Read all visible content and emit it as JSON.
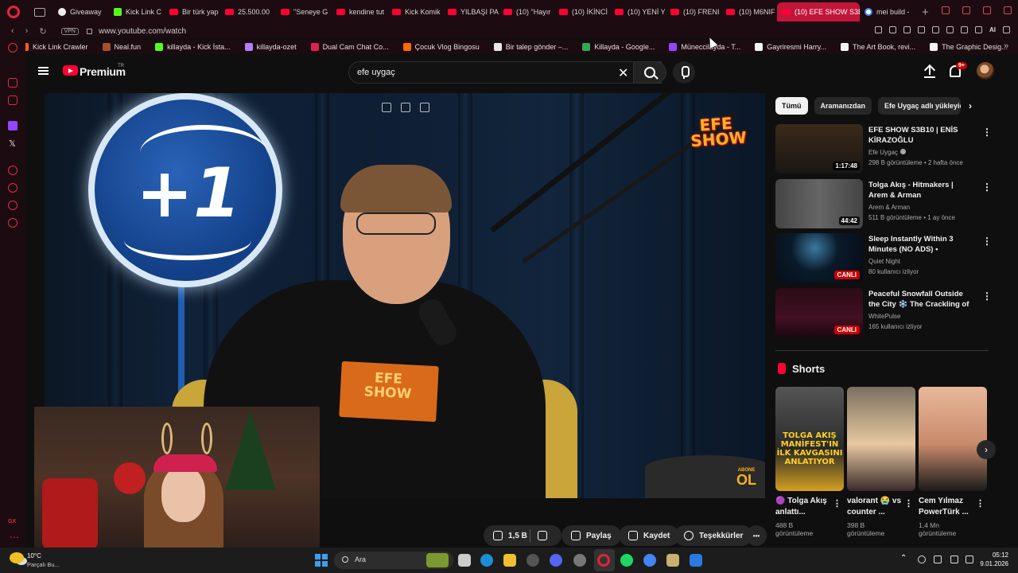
{
  "browser": {
    "tabs": [
      {
        "label": "Giveaway",
        "icon": "github-icon"
      },
      {
        "label": "Kick Link C",
        "icon": "kick-icon"
      },
      {
        "label": "Bir türk yap",
        "icon": "youtube-icon"
      },
      {
        "label": "25.500.00",
        "icon": "youtube-icon"
      },
      {
        "label": "\"Seneye G",
        "icon": "youtube-icon"
      },
      {
        "label": "kendine tut",
        "icon": "youtube-icon"
      },
      {
        "label": "Kick Komik",
        "icon": "youtube-icon"
      },
      {
        "label": "YILBAŞI PA",
        "icon": "youtube-icon"
      },
      {
        "label": "(10) \"Hayır",
        "icon": "youtube-icon"
      },
      {
        "label": "(10) İKİNCİ",
        "icon": "youtube-icon"
      },
      {
        "label": "(10) YENİ Y",
        "icon": "youtube-icon"
      },
      {
        "label": "(10) FRENI",
        "icon": "youtube-icon"
      },
      {
        "label": "(10) M6NIF",
        "icon": "youtube-icon"
      },
      {
        "label": "(10) EFE SHOW S3B",
        "icon": "youtube-icon",
        "active": true
      },
      {
        "label": "mei build -",
        "icon": "google-icon"
      }
    ],
    "new_tab": "+",
    "vpn": "VPN",
    "url": "www.youtube.com/watch",
    "ai_label": "AI",
    "bookmarks": [
      {
        "label": "Kick Link Crawler",
        "color": "#ff6020"
      },
      {
        "label": "Neal.fun",
        "color": "#a0522d"
      },
      {
        "label": "killayda - Kick İsta...",
        "color": "#53fc18"
      },
      {
        "label": "killayda-ozet",
        "color": "#b080ff"
      },
      {
        "label": "Dual Cam Chat Co...",
        "color": "#e02050"
      },
      {
        "label": "Çocuk Vlog Bingosu",
        "color": "#ff6a00"
      },
      {
        "label": "Bir talep gönder –...",
        "color": "#e8e8e8"
      },
      {
        "label": "Killayda - Google...",
        "color": "#34a853"
      },
      {
        "label": "Müneccilayda - T...",
        "color": "#9146ff"
      },
      {
        "label": "Gayriresmi Harry...",
        "color": "#f5f5f5"
      },
      {
        "label": "The Art Book, revi...",
        "color": "#f5f5f5"
      },
      {
        "label": "The Graphic Desig...",
        "color": "#f5f5f5"
      }
    ]
  },
  "youtube": {
    "brand": "Premium",
    "region": "TR",
    "search": {
      "value": "efe uygaç",
      "clear": "✕"
    },
    "notification_badge": "9+",
    "player": {
      "efe_logo": "EFE SHOW",
      "book_text": "EFE SHOW",
      "plus_one": "+1",
      "abone_small": "ABONE",
      "abone_big": "OL"
    },
    "actions": {
      "like_count": "1,5 B",
      "share": "Paylaş",
      "save": "Kaydet",
      "thanks": "Teşekkürler",
      "more": "•••"
    },
    "chips": [
      "Tümü",
      "Aramanızdan",
      "Efe Uygaç adlı yükleyiciden"
    ],
    "recommendations": [
      {
        "title": "EFE SHOW S3B10 | ENİS KİRAZOĞLU",
        "channel": "Efe Uygaç",
        "verified": true,
        "meta": "298 B görüntüleme • 2 hafta önce",
        "badge": "1:17:48",
        "live": false
      },
      {
        "title": "Tolga Akış - Hitmakers | Arem & Arman",
        "channel": "Arem & Arman",
        "verified": false,
        "meta": "511 B görüntüleme • 1 ay önce",
        "badge": "44:42",
        "live": false
      },
      {
        "title": "Sleep Instantly Within 3 Minutes (NO ADS) • Eliminate Stress & ...",
        "channel": "Quiet Night",
        "verified": false,
        "meta": "80 kullanıcı izliyor",
        "badge": "CANLI",
        "live": true
      },
      {
        "title": "Peaceful Snowfall Outside the City ❄️ The Crackling of the ...",
        "channel": "WhitePulse",
        "verified": false,
        "meta": "165 kullanıcı izliyor",
        "badge": "CANLI",
        "live": true
      }
    ],
    "shorts_title": "Shorts",
    "shorts": [
      {
        "title": "🟣 Tolga Akış anlattı...",
        "views": "488 B",
        "views_label": "görüntüleme",
        "overlay": "TOLGA AKIŞ MANİFEST'IN İLK KAVGASINI ANLATIYOR"
      },
      {
        "title": "valorant 😭 vs counter ...",
        "views": "398 B",
        "views_label": "görüntüleme",
        "overlay": ""
      },
      {
        "title": "Cem Yılmaz PowerTürk ...",
        "views": "1,4 Mn",
        "views_label": "görüntüleme",
        "overlay": ""
      }
    ]
  },
  "taskbar": {
    "weather_temp": "10°C",
    "weather_desc": "Parçalı Bu...",
    "search_label": "Ara",
    "time": "05:12",
    "date": "9.01.2026"
  }
}
